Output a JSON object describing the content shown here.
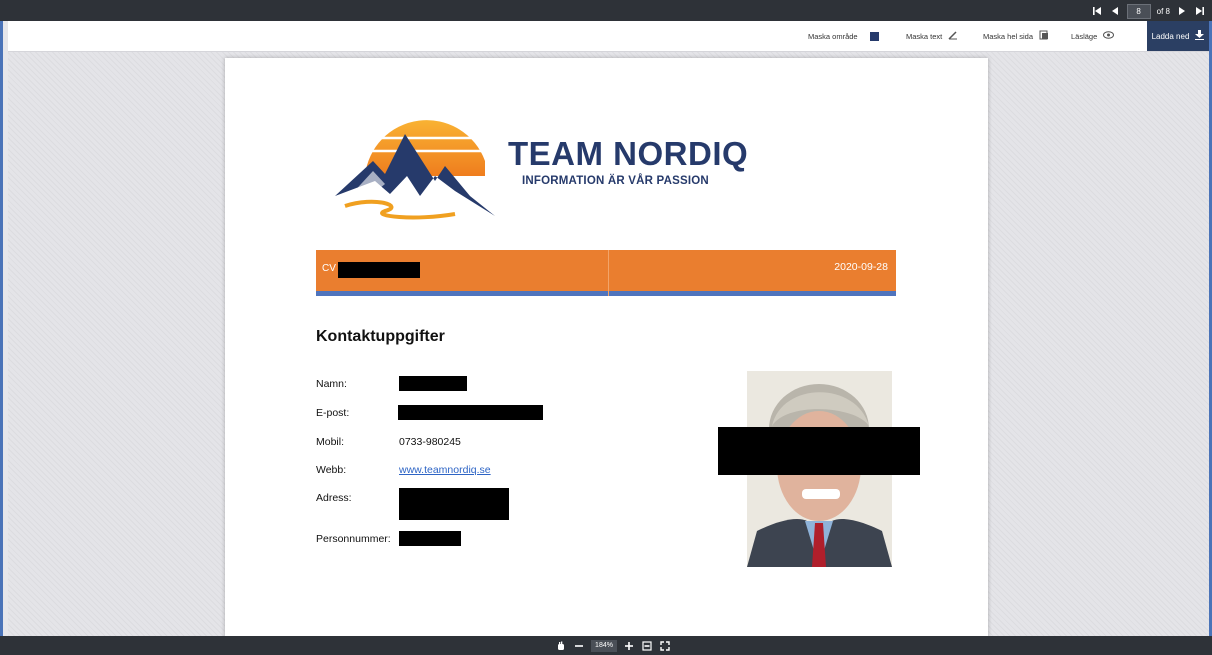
{
  "pager": {
    "current_page": "8",
    "of_label": "of 8"
  },
  "toolbar": {
    "mask_area": "Maska område",
    "mask_text": "Maska text",
    "mask_page": "Maska hel sida",
    "read_mode": "Läsläge",
    "download": "Ladda ned"
  },
  "document": {
    "brand_name": "TEAM NORDIQ",
    "brand_tagline": "INFORMATION ÄR VÅR PASSION",
    "cv_label": "CV",
    "date": "2020-09-28",
    "section_title": "Kontaktuppgifter",
    "fields": {
      "name_label": "Namn:",
      "email_label": "E-post:",
      "mobile_label": "Mobil:",
      "mobile_value": "0733-980245",
      "web_label": "Webb:",
      "web_value": "www.teamnordiq.se",
      "address_label": "Adress:",
      "personal_number_label": "Personnummer:"
    }
  },
  "zoom": {
    "level": "184%"
  },
  "colors": {
    "accent_orange": "#ea7e2f",
    "banner_line_blue": "#4f74bd",
    "brand_navy": "#263a6b",
    "download_bg": "#2b3f63"
  }
}
